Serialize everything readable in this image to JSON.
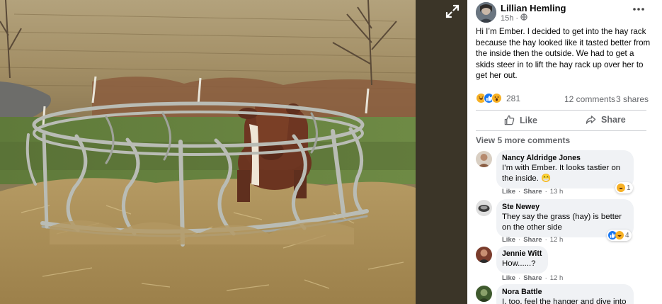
{
  "post": {
    "author": "Lillian Hemling",
    "time": "15h",
    "text": "Hi I’m Ember. I decided to get into the hay rack because the hay looked like it tasted better from the inside then the outside. We had to get a skids steer in to lift the hay rack up over her to get her out.",
    "reaction_count": "281",
    "comment_count": "12 comments",
    "share_count": "3 shares",
    "reactions": [
      "haha",
      "like",
      "wow"
    ]
  },
  "actions": {
    "like": "Like",
    "share": "Share"
  },
  "view_more": "View 5 more comments",
  "comments": [
    {
      "name": "Nancy Aldridge Jones",
      "text": "I’m with Ember. It looks tastier on the inside. 😁",
      "like": "Like",
      "share": "Share",
      "time": "13 h",
      "reaction_count": "1"
    },
    {
      "name": "Ste Newey",
      "text": "They say the grass (hay) is better on the other side",
      "like": "Like",
      "share": "Share",
      "time": "12 h",
      "reaction_count": "4"
    },
    {
      "name": "Jennie Witt",
      "text": "How......?",
      "like": "Like",
      "share": "Share",
      "time": "12 h"
    },
    {
      "name": "Nora Battle",
      "text": "I, too, feel the hanger and dive into"
    }
  ],
  "separator": "·",
  "colors": {
    "like_blue": "#1877f2",
    "text_secondary": "#65676b",
    "bubble_bg": "#f0f2f5"
  },
  "icons": [
    "expand-icon",
    "globe-icon",
    "more-icon",
    "thumbs-up-icon",
    "share-arrow-icon"
  ]
}
